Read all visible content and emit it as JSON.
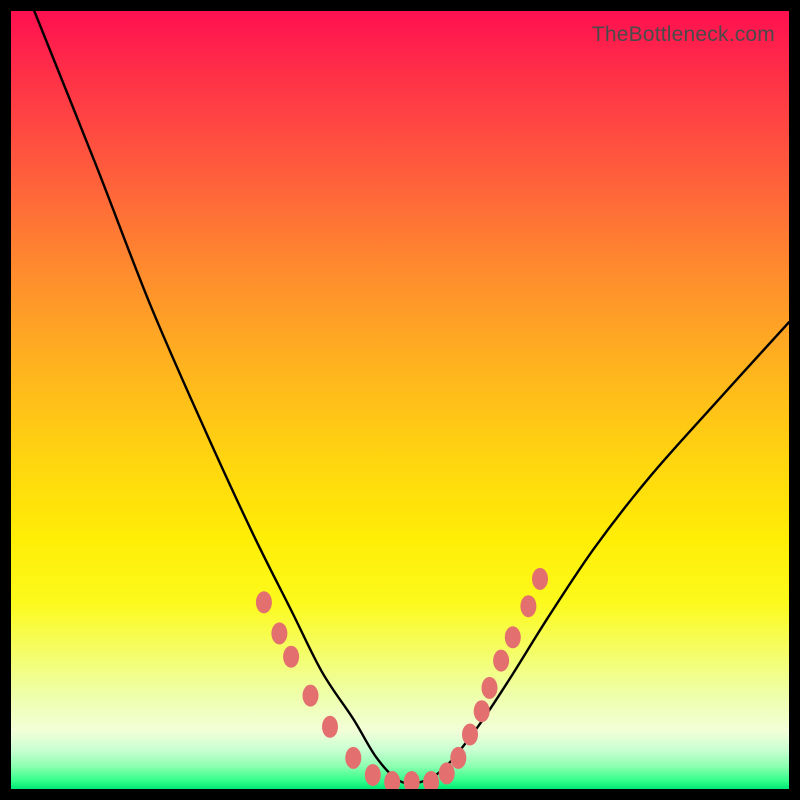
{
  "watermark": "TheBottleneck.com",
  "chart_data": {
    "type": "line",
    "title": "",
    "xlabel": "",
    "ylabel": "",
    "xlim": [
      0,
      100
    ],
    "ylim": [
      0,
      100
    ],
    "series": [
      {
        "name": "bottleneck-curve",
        "x": [
          3,
          11,
          18,
          25,
          31,
          36,
          40,
          44,
          47,
          50,
          53,
          56,
          60,
          64,
          69,
          75,
          82,
          90,
          100
        ],
        "values": [
          100,
          80,
          62,
          46,
          33,
          23,
          15,
          9,
          4,
          1,
          1,
          3,
          8,
          14,
          22,
          31,
          40,
          49,
          60
        ]
      }
    ],
    "markers": {
      "name": "highlight-dots",
      "color": "#e36f6f",
      "points_xy": [
        [
          32.5,
          24.0
        ],
        [
          34.5,
          20.0
        ],
        [
          36.0,
          17.0
        ],
        [
          38.5,
          12.0
        ],
        [
          41.0,
          8.0
        ],
        [
          44.0,
          4.0
        ],
        [
          46.5,
          1.8
        ],
        [
          49.0,
          0.9
        ],
        [
          51.5,
          0.9
        ],
        [
          54.0,
          0.9
        ],
        [
          56.0,
          2.0
        ],
        [
          57.5,
          4.0
        ],
        [
          59.0,
          7.0
        ],
        [
          60.5,
          10.0
        ],
        [
          61.5,
          13.0
        ],
        [
          63.0,
          16.5
        ],
        [
          64.5,
          19.5
        ],
        [
          66.5,
          23.5
        ],
        [
          68.0,
          27.0
        ]
      ]
    }
  }
}
